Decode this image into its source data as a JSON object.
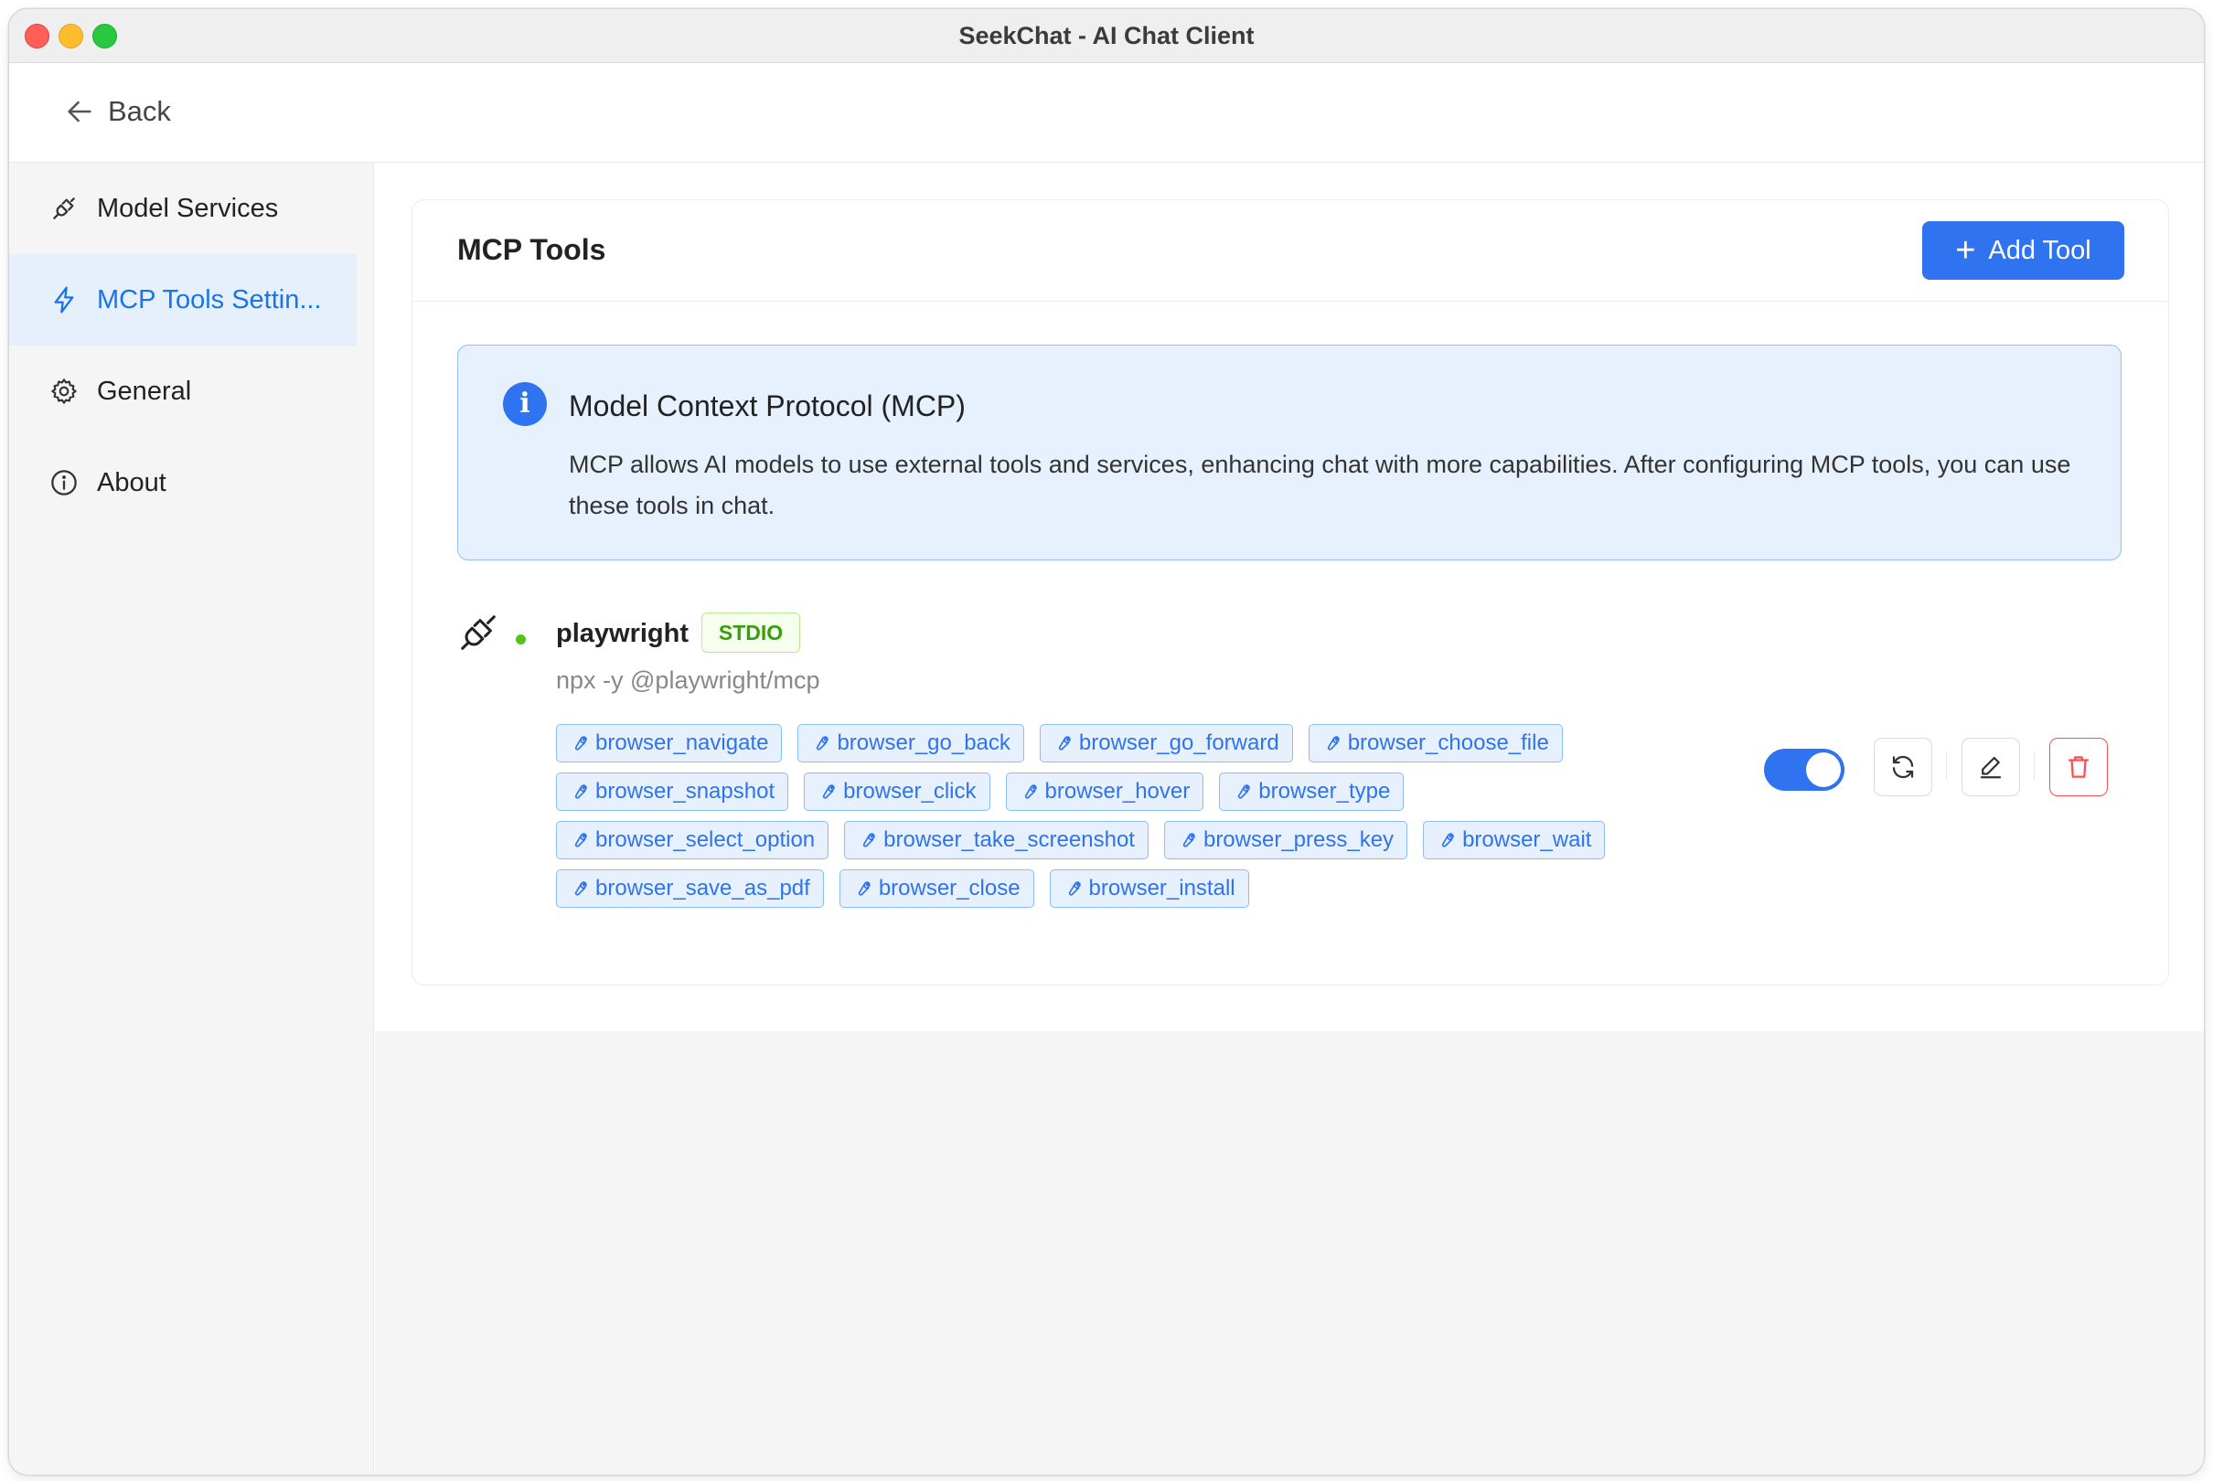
{
  "window": {
    "title": "SeekChat - AI Chat Client"
  },
  "topbar": {
    "back_label": "Back"
  },
  "sidebar": {
    "items": [
      {
        "label": "Model Services",
        "icon": "plug-icon",
        "active": false
      },
      {
        "label": "MCP Tools Settin...",
        "icon": "lightning-icon",
        "active": true
      },
      {
        "label": "General",
        "icon": "gear-icon",
        "active": false
      },
      {
        "label": "About",
        "icon": "info-circle-icon",
        "active": false
      }
    ]
  },
  "main": {
    "title": "MCP Tools",
    "add_button_label": "Add Tool",
    "info": {
      "title": "Model Context Protocol (MCP)",
      "description": "MCP allows AI models to use external tools and services, enhancing chat with more capabilities. After configuring MCP tools, you can use these tools in chat."
    },
    "server": {
      "name": "playwright",
      "transport": "STDIO",
      "command": "npx -y @playwright/mcp",
      "status": "connected",
      "enabled": true,
      "tools": [
        "browser_navigate",
        "browser_go_back",
        "browser_go_forward",
        "browser_choose_file",
        "browser_snapshot",
        "browser_click",
        "browser_hover",
        "browser_type",
        "browser_select_option",
        "browser_take_screenshot",
        "browser_press_key",
        "browser_wait",
        "browser_save_as_pdf",
        "browser_close",
        "browser_install"
      ]
    }
  },
  "colors": {
    "accent": "#2f73f0",
    "status_ok": "#52c41a",
    "danger": "#ff4d4f",
    "info_bg": "#e7f1fd"
  }
}
